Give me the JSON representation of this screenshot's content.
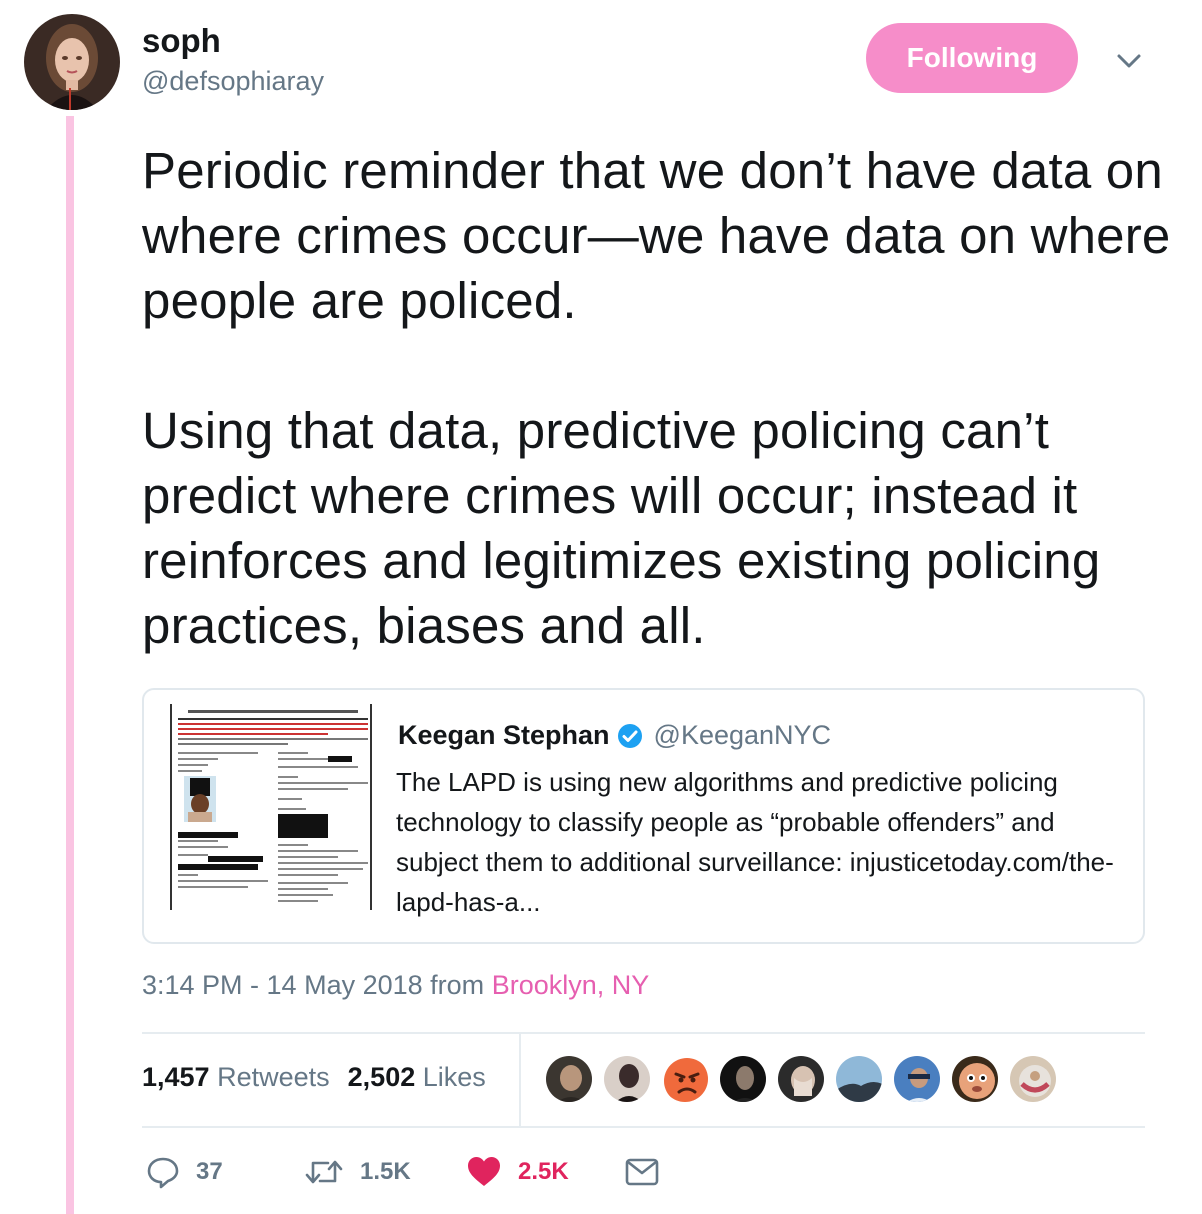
{
  "author": {
    "name": "soph",
    "handle": "@defsophiaray"
  },
  "follow_button": {
    "label": "Following",
    "color": "#f68dc9"
  },
  "menu_icon": "chevron-down-icon",
  "tweet": {
    "paragraphs": [
      "Periodic reminder that we don’t have data on where crimes occur—we have data on where people are policed.",
      "Using that data, predictive policing can’t predict where crimes will occur; instead it reinforces and legitimizes existing policing practices, biases and all."
    ]
  },
  "quoted_tweet": {
    "name": "Keegan Stephan",
    "verified": true,
    "handle": "@KeeganNYC",
    "text": "The LAPD is using new algorithms and predictive policing technology to classify people as “probable offenders” and subject them to additional surveillance: injusticetoday.com/the-lapd-has-a..."
  },
  "meta": {
    "timestamp": "3:14 PM - 14 May 2018",
    "from_label": "from",
    "location": "Brooklyn, NY",
    "location_color": "#e65fb0"
  },
  "stats": {
    "retweets_count": "1,457",
    "retweets_label": "Retweets",
    "likes_count": "2,502",
    "likes_label": "Likes",
    "liker_avatar_count": 9
  },
  "actions": {
    "reply_count": "37",
    "retweet_count": "1.5K",
    "like_count": "2.5K",
    "like_color": "#e0245e"
  },
  "thread_line_color": "#fac4e2"
}
